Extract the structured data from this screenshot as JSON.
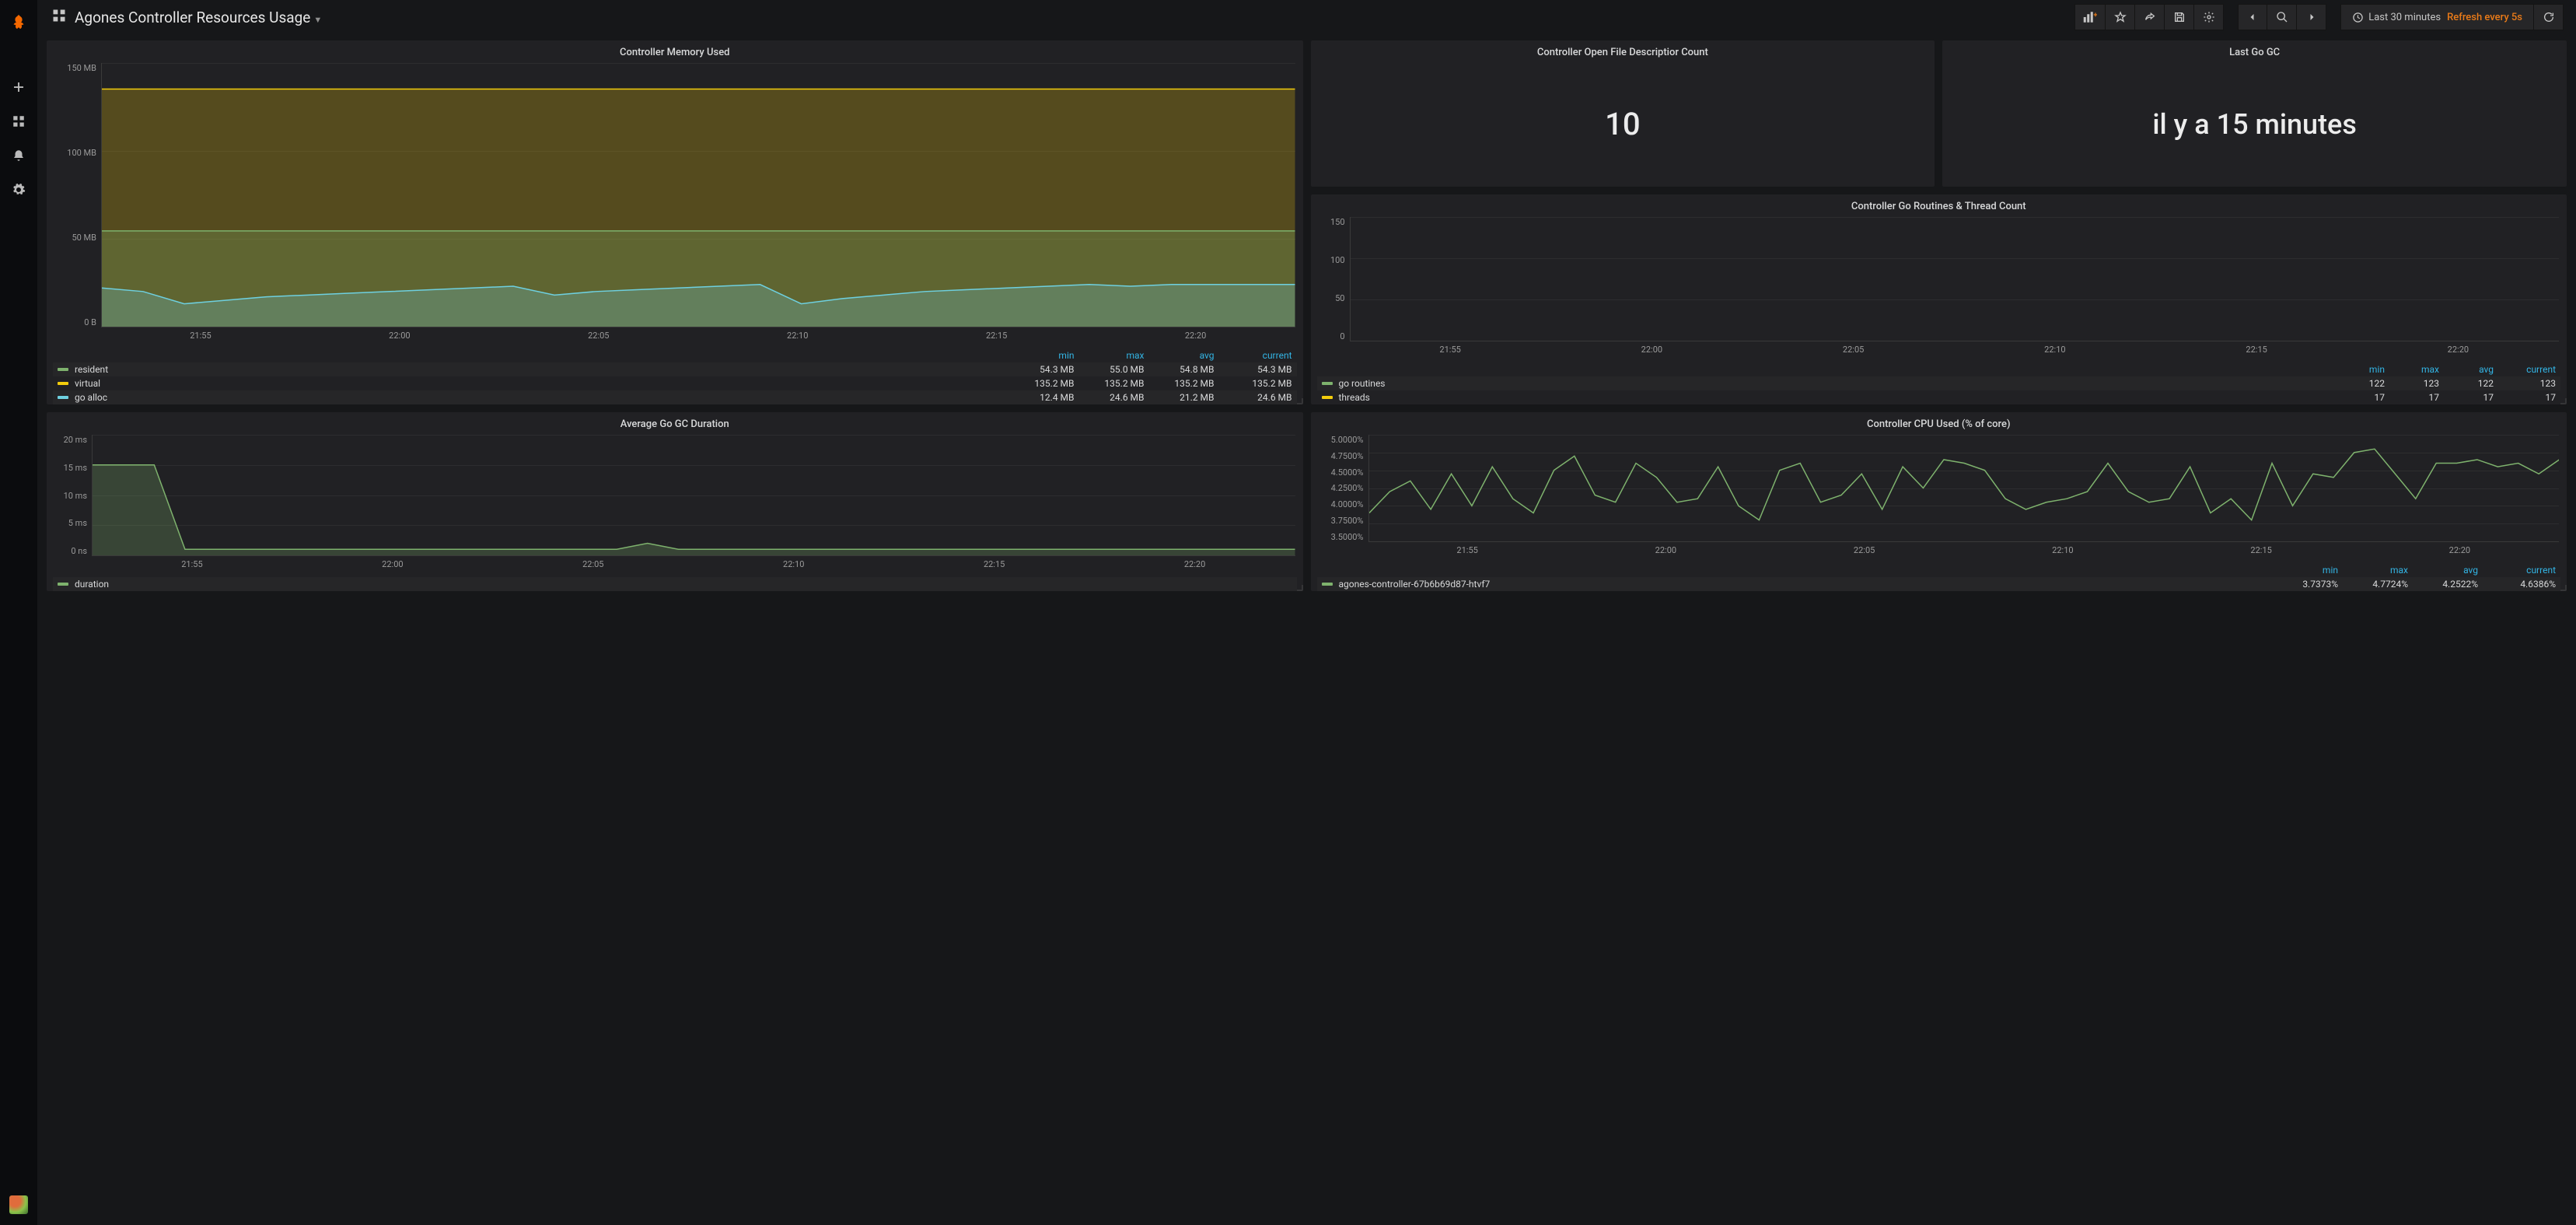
{
  "header": {
    "title": "Agones Controller Resources Usage",
    "time_range": "Last 30 minutes",
    "refresh": "Refresh every 5s"
  },
  "sidenav": {
    "logo": "grafana-logo",
    "items": [
      "create",
      "dashboards",
      "alerting",
      "configuration"
    ]
  },
  "toolbar_icons": [
    "add-panel",
    "star",
    "share",
    "save",
    "settings",
    "prev",
    "zoom",
    "next",
    "refresh"
  ],
  "x_ticks": [
    "21:55",
    "22:00",
    "22:05",
    "22:10",
    "22:15",
    "22:20"
  ],
  "legend_headers": [
    "min",
    "max",
    "avg",
    "current"
  ],
  "panels": {
    "fd": {
      "title": "Controller Open File Descriptior Count",
      "value": "10"
    },
    "gc": {
      "title": "Last Go GC",
      "value": "il y a 15 minutes"
    },
    "routines": {
      "title": "Controller Go Routines & Thread Count",
      "series": [
        {
          "name": "go routines",
          "color": "#7eb26d",
          "min": "122",
          "max": "123",
          "avg": "122",
          "current": "123"
        },
        {
          "name": "threads",
          "color": "#f2cc0c",
          "min": "17",
          "max": "17",
          "avg": "17",
          "current": "17"
        }
      ]
    },
    "gcdur": {
      "title": "Average Go GC Duration",
      "series": [
        {
          "name": "duration",
          "color": "#7eb26d"
        }
      ]
    },
    "memory": {
      "title": "Controller Memory Used",
      "series": [
        {
          "name": "resident",
          "color": "#7eb26d",
          "min": "54.3 MB",
          "max": "55.0 MB",
          "avg": "54.8 MB",
          "current": "54.3 MB"
        },
        {
          "name": "virtual",
          "color": "#f2cc0c",
          "min": "135.2 MB",
          "max": "135.2 MB",
          "avg": "135.2 MB",
          "current": "135.2 MB"
        },
        {
          "name": "go alloc",
          "color": "#6ed0e0",
          "min": "12.4 MB",
          "max": "24.6 MB",
          "avg": "21.2 MB",
          "current": "24.6 MB"
        }
      ]
    },
    "cpu": {
      "title": "Controller CPU Used (% of core)",
      "series": [
        {
          "name": "agones-controller-67b6b69d87-htvf7",
          "color": "#7eb26d",
          "min": "3.7373%",
          "max": "4.7724%",
          "avg": "4.2522%",
          "current": "4.6386%"
        }
      ]
    }
  },
  "chart_data": [
    {
      "type": "bar",
      "title": "Controller Go Routines & Thread Count",
      "x": [
        "21:55",
        "22:00",
        "22:05",
        "22:10",
        "22:15",
        "22:20"
      ],
      "ylim": [
        0,
        150
      ],
      "yticks": [
        0,
        50,
        100,
        150
      ],
      "stacked": true,
      "series": [
        {
          "name": "threads",
          "value_constant": 17
        },
        {
          "name": "go routines",
          "value_constant": 122
        }
      ]
    },
    {
      "type": "line",
      "title": "Average Go GC Duration",
      "x": [
        "21:55",
        "22:00",
        "22:05",
        "22:10",
        "22:15",
        "22:20"
      ],
      "ylabel": "",
      "yticks": [
        "0 ns",
        "5 ms",
        "10 ms",
        "15 ms",
        "20 ms"
      ],
      "ylim_ms": [
        0,
        20
      ],
      "series": [
        {
          "name": "duration",
          "values_ms": [
            15,
            15,
            15,
            1,
            1,
            1,
            1,
            1,
            1,
            1,
            1,
            1,
            1,
            1,
            1,
            1,
            1,
            1,
            2,
            1,
            1,
            1,
            1,
            1,
            1,
            1,
            1,
            1,
            1,
            1,
            1,
            1,
            1,
            1,
            1,
            1,
            1,
            1,
            1,
            1
          ]
        }
      ]
    },
    {
      "type": "area",
      "title": "Controller Memory Used",
      "x": [
        "21:55",
        "22:00",
        "22:05",
        "22:10",
        "22:15",
        "22:20"
      ],
      "yticks": [
        "0 B",
        "50 MB",
        "100 MB",
        "150 MB"
      ],
      "ylim_mb": [
        0,
        150
      ],
      "series": [
        {
          "name": "virtual",
          "value_constant_mb": 135.2
        },
        {
          "name": "resident",
          "value_constant_mb": 54.5
        },
        {
          "name": "go alloc",
          "values_mb": [
            22,
            20,
            13,
            15,
            17,
            18,
            19,
            20,
            21,
            22,
            23,
            18,
            20,
            21,
            22,
            23,
            24,
            13,
            16,
            18,
            20,
            21,
            22,
            23,
            24,
            23,
            24,
            24,
            24,
            24
          ]
        }
      ]
    },
    {
      "type": "line",
      "title": "Controller CPU Used (% of core)",
      "x": [
        "21:55",
        "22:00",
        "22:05",
        "22:10",
        "22:15",
        "22:20"
      ],
      "yticks": [
        "3.5000%",
        "3.7500%",
        "4.0000%",
        "4.2500%",
        "4.5000%",
        "4.7500%",
        "5.0000%"
      ],
      "ylim_pct": [
        3.5,
        5.0
      ],
      "series": [
        {
          "name": "agones-controller-67b6b69d87-htvf7",
          "values_pct": [
            3.9,
            4.2,
            4.35,
            3.95,
            4.45,
            4.0,
            4.55,
            4.1,
            3.9,
            4.5,
            4.7,
            4.15,
            4.05,
            4.6,
            4.4,
            4.05,
            4.1,
            4.55,
            4.0,
            3.8,
            4.5,
            4.6,
            4.05,
            4.15,
            4.45,
            3.95,
            4.55,
            4.25,
            4.65,
            4.6,
            4.5,
            4.1,
            3.95,
            4.05,
            4.1,
            4.2,
            4.6,
            4.2,
            4.05,
            4.1,
            4.55,
            3.9,
            4.1,
            3.8,
            4.6,
            4.0,
            4.45,
            4.4,
            4.75,
            4.8,
            4.45,
            4.1,
            4.6,
            4.6,
            4.65,
            4.55,
            4.6,
            4.45,
            4.65
          ]
        }
      ]
    }
  ]
}
